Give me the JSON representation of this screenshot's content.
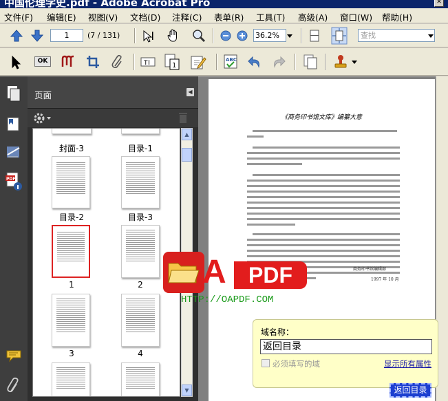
{
  "window": {
    "title": "中国伦理学史.pdf - Adobe Acrobat Pro"
  },
  "menu": [
    "文件(F)",
    "编辑(E)",
    "视图(V)",
    "文档(D)",
    "注释(C)",
    "表单(R)",
    "工具(T)",
    "高级(A)",
    "窗口(W)",
    "帮助(H)"
  ],
  "toolbar": {
    "page_value": "1",
    "page_count": "(7 / 131)",
    "zoom_value": "36.2%",
    "search_placeholder": "查找"
  },
  "panel": {
    "title": "页面"
  },
  "thumbnails": [
    {
      "label": "封面-3"
    },
    {
      "label": "目录-1"
    },
    {
      "label": "目录-2"
    },
    {
      "label": "目录-3"
    },
    {
      "label": "1"
    },
    {
      "label": "2"
    },
    {
      "label": "3"
    },
    {
      "label": "4"
    }
  ],
  "document": {
    "heading": "《商务印书馆文库》编纂大意",
    "signature": "商务印书馆编辑部",
    "date": "1997 年 10 月"
  },
  "watermark": {
    "a": "A",
    "pdf": "PDF",
    "url": "HTTP://OAPDF.COM"
  },
  "field_tooltip": {
    "label": "域名称：",
    "value": "返回目录",
    "required": "必须填写的域",
    "show_all": "显示所有属性"
  },
  "field_highlight": {
    "text": "返回目录"
  },
  "colors": {
    "accent": "#1d3fd0",
    "logo_red": "#e21d1d",
    "url_green": "#1a9b1a"
  }
}
